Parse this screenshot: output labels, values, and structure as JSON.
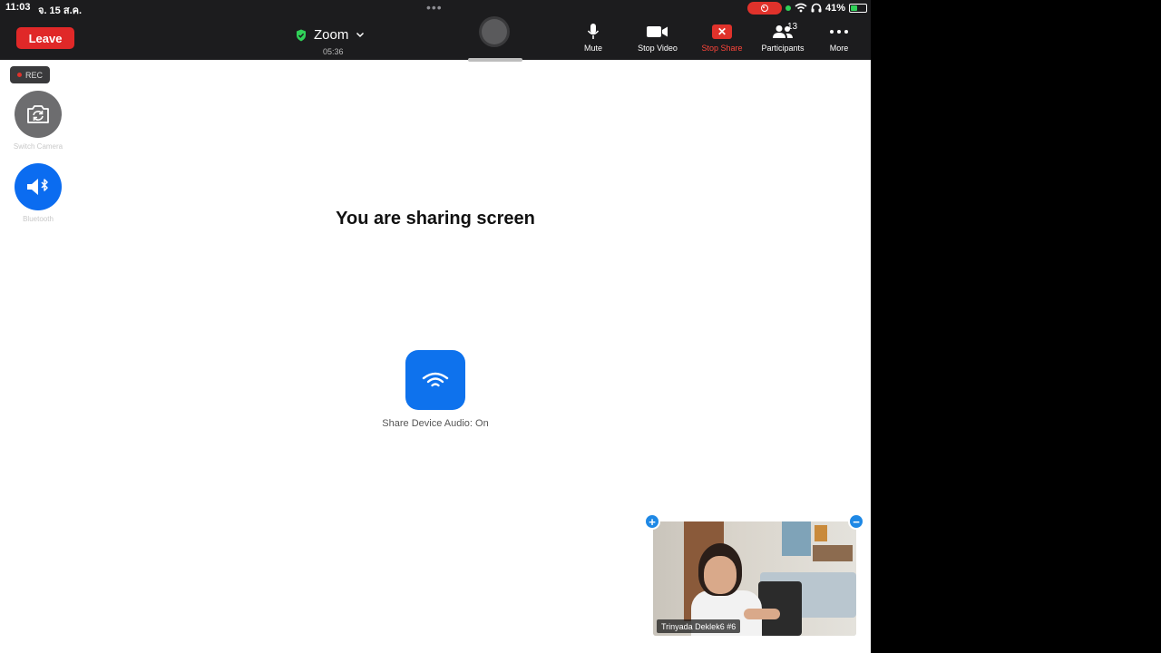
{
  "status_bar": {
    "time": "11:03",
    "date": "จ. 15 ส.ค.",
    "battery": "41%"
  },
  "toolbar": {
    "leave_label": "Leave",
    "meeting_title": "Zoom",
    "timer": "05:36",
    "mute_label": "Mute",
    "stop_video_label": "Stop Video",
    "stop_share_label": "Stop Share",
    "participants_label": "Participants",
    "participants_count": "13",
    "more_label": "More"
  },
  "side_controls": {
    "rec_label": "REC",
    "switch_camera_label": "Switch Camera",
    "bluetooth_label": "Bluetooth"
  },
  "share": {
    "title": "You are sharing screen",
    "audio_label": "Share Device Audio: On"
  },
  "self_view": {
    "name": "Trinyada Deklek6 #6"
  },
  "colors": {
    "leave_red": "#e02828",
    "zoom_blue": "#0e72ed",
    "toolbar_bg": "#1c1c1e"
  }
}
